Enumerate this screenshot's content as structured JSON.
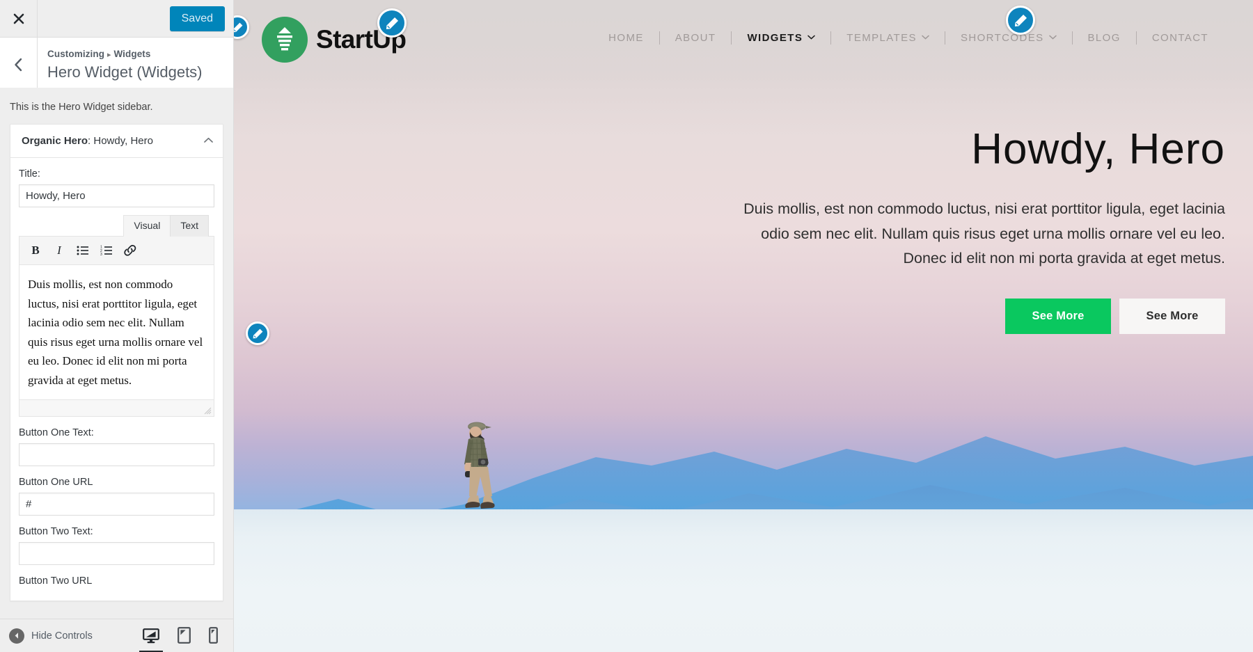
{
  "customizer": {
    "close_label": "Close",
    "save_button": "Saved",
    "back_label": "Back",
    "breadcrumb_root": "Customizing",
    "breadcrumb_sep": "▸",
    "breadcrumb_section": "Widgets",
    "panel_title": "Hero Widget (Widgets)",
    "sidebar_description": "This is the Hero Widget sidebar.",
    "widget": {
      "type_label": "Organic Hero",
      "separator": ": ",
      "instance_title": "Howdy, Hero",
      "toggle_icon": "chevron-up-icon",
      "fields": {
        "title_label": "Title:",
        "title_value": "Howdy, Hero",
        "button_one_text_label": "Button One Text:",
        "button_one_text_value": "",
        "button_one_text_placeholder": "",
        "button_one_url_label": "Button One URL",
        "button_one_url_value": "#",
        "button_two_text_label": "Button Two Text:",
        "button_two_text_value": "",
        "button_two_url_label": "Button Two URL"
      },
      "editor": {
        "tab_visual": "Visual",
        "tab_text": "Text",
        "active_tab": "Visual",
        "toolbar": [
          {
            "name": "bold-icon",
            "glyph": "B"
          },
          {
            "name": "italic-icon",
            "glyph": "I"
          },
          {
            "name": "bulleted-list-icon",
            "glyph": ""
          },
          {
            "name": "numbered-list-icon",
            "glyph": ""
          },
          {
            "name": "link-icon",
            "glyph": ""
          }
        ],
        "content": "Duis mollis, est non commodo luctus, nisi erat porttitor ligula, eget lacinia odio sem nec elit. Nullam quis risus eget urna mollis ornare vel eu leo. Donec id elit non mi porta gravida at eget metus."
      }
    },
    "footer": {
      "collapse_label": "Hide Controls",
      "collapse_icon": "caret-left-circle-icon",
      "devices": [
        {
          "name": "desktop-preview",
          "icon": "desktop-icon",
          "active": true
        },
        {
          "name": "tablet-preview",
          "icon": "tablet-icon",
          "active": false
        },
        {
          "name": "mobile-preview",
          "icon": "mobile-icon",
          "active": false
        }
      ]
    }
  },
  "preview": {
    "brand": {
      "logo_icon": "startup-pyramid-logo-icon",
      "name": "StartUp"
    },
    "nav": [
      {
        "label": "HOME",
        "active": false,
        "has_dropdown": false
      },
      {
        "label": "ABOUT",
        "active": false,
        "has_dropdown": false
      },
      {
        "label": "WIDGETS",
        "active": true,
        "has_dropdown": true
      },
      {
        "label": "TEMPLATES",
        "active": false,
        "has_dropdown": true
      },
      {
        "label": "SHORTCODES",
        "active": false,
        "has_dropdown": true
      },
      {
        "label": "BLOG",
        "active": false,
        "has_dropdown": false
      },
      {
        "label": "CONTACT",
        "active": false,
        "has_dropdown": false
      }
    ],
    "nav_caret_icon": "chevron-down-icon",
    "hero": {
      "title": "Howdy, Hero",
      "text": "Duis mollis, est non commodo luctus, nisi erat porttitor ligula, eget lacinia odio sem nec elit. Nullam quis risus eget urna mollis ornare vel eu leo. Donec id elit non mi porta gravida at eget metus.",
      "button_one": "See More",
      "button_two": "See More"
    },
    "edit_pins": [
      {
        "name": "edit-shortcut-header",
        "icon": "pencil-icon"
      },
      {
        "name": "edit-shortcut-logo",
        "icon": "pencil-icon"
      },
      {
        "name": "edit-shortcut-nav",
        "icon": "pencil-icon"
      },
      {
        "name": "edit-shortcut-hero",
        "icon": "pencil-icon"
      }
    ]
  },
  "colors": {
    "wp_blue": "#0085ba",
    "pin_blue": "#0e84bd",
    "brand_green": "#32a05f",
    "button_green": "#0ac85f",
    "sidebar_bg": "#eeeeee",
    "text_dark": "#32373c"
  }
}
